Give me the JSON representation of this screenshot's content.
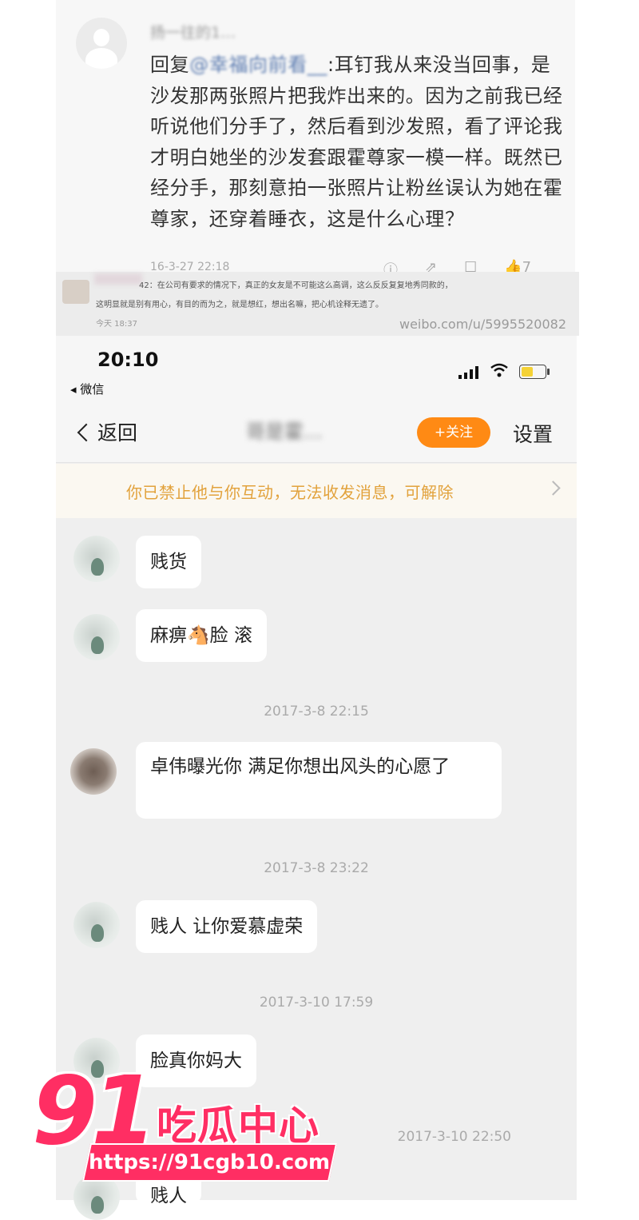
{
  "comment": {
    "username": "扬一往的1…",
    "reply_prefix": "回复",
    "mention": "@幸福向前看__",
    "text": ":耳钉我从来没当回事，是沙发那两张照片把我炸出来的。因为之前我已经听说他们分手了，然后看到沙发照，看了评论我才明白她坐的沙发套跟霍尊家一模一样。既然已经分手，那刻意拍一张照片让粉丝误认为她在霍尊家，还穿着睡衣，这是什么心理？",
    "timestamp": "16-3-27 22:18",
    "like_count": "7"
  },
  "reply": {
    "line1": "42：在公司有要求的情况下，真正的女友是不可能这么高调，这么反反复复地秀同款的，",
    "line2": "这明显就是别有用心，有目的而为之，就是想红，想出名嘛，把心机诠释无遗了。",
    "time": "今天 18:37",
    "watermark": "weibo.com/u/5995520082"
  },
  "status_bar": {
    "time": "20:10",
    "back_app": "◂ 微信"
  },
  "nav": {
    "back_label": "返回",
    "title": "哥是霍…",
    "follow_label": "+关注",
    "settings_label": "设置"
  },
  "banner": {
    "text": "你已禁止他与你互动，无法收发消息，可解除"
  },
  "chat": {
    "messages": [
      {
        "text": "贱货"
      },
      {
        "text": "麻痹🐴脸 滚"
      },
      {
        "text": "卓伟曝光你 满足你想出风头的心愿了"
      },
      {
        "text": "贱人 让你爱慕虚荣"
      },
      {
        "text": "脸真你妈大"
      },
      {
        "text": "贱人"
      }
    ],
    "times": [
      "2017-3-8 22:15",
      "2017-3-8 23:22",
      "2017-3-10 17:59",
      "2017-3-10 22:50"
    ]
  },
  "logo": {
    "number": "91",
    "name": "吃瓜中心",
    "url": "https://91cgb10.com",
    "color": "#ff2e63"
  },
  "colors": {
    "follow_button": "#ff8a14",
    "banner_text": "#e2a23c",
    "chat_background": "#efefef"
  }
}
